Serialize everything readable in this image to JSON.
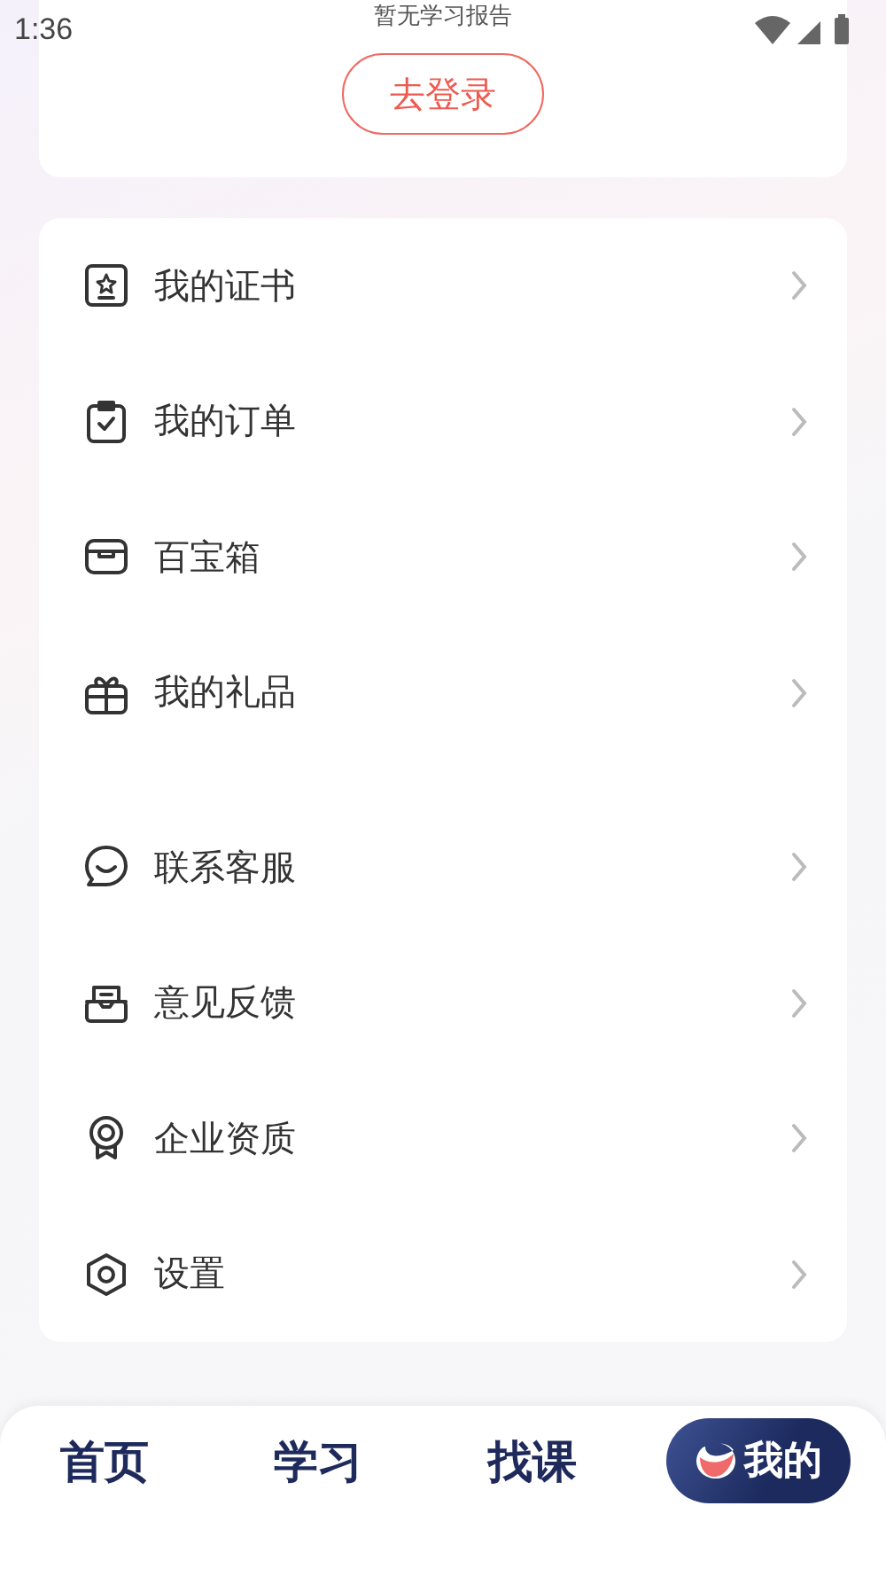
{
  "status_bar": {
    "time": "1:36"
  },
  "profile_card": {
    "report_text": "暂无学习报告",
    "login_button": "去登录"
  },
  "menu_groups": [
    {
      "items": [
        {
          "label": "我的证书"
        },
        {
          "label": "我的订单"
        },
        {
          "label": "百宝箱"
        },
        {
          "label": "我的礼品"
        }
      ]
    },
    {
      "items": [
        {
          "label": "联系客服"
        },
        {
          "label": "意见反馈"
        },
        {
          "label": "企业资质"
        },
        {
          "label": "设置"
        }
      ]
    }
  ],
  "bottom_nav": [
    {
      "label": "首页",
      "selected": false
    },
    {
      "label": "学习",
      "selected": false
    },
    {
      "label": "找课",
      "selected": false
    },
    {
      "label": "我的",
      "selected": true
    }
  ]
}
